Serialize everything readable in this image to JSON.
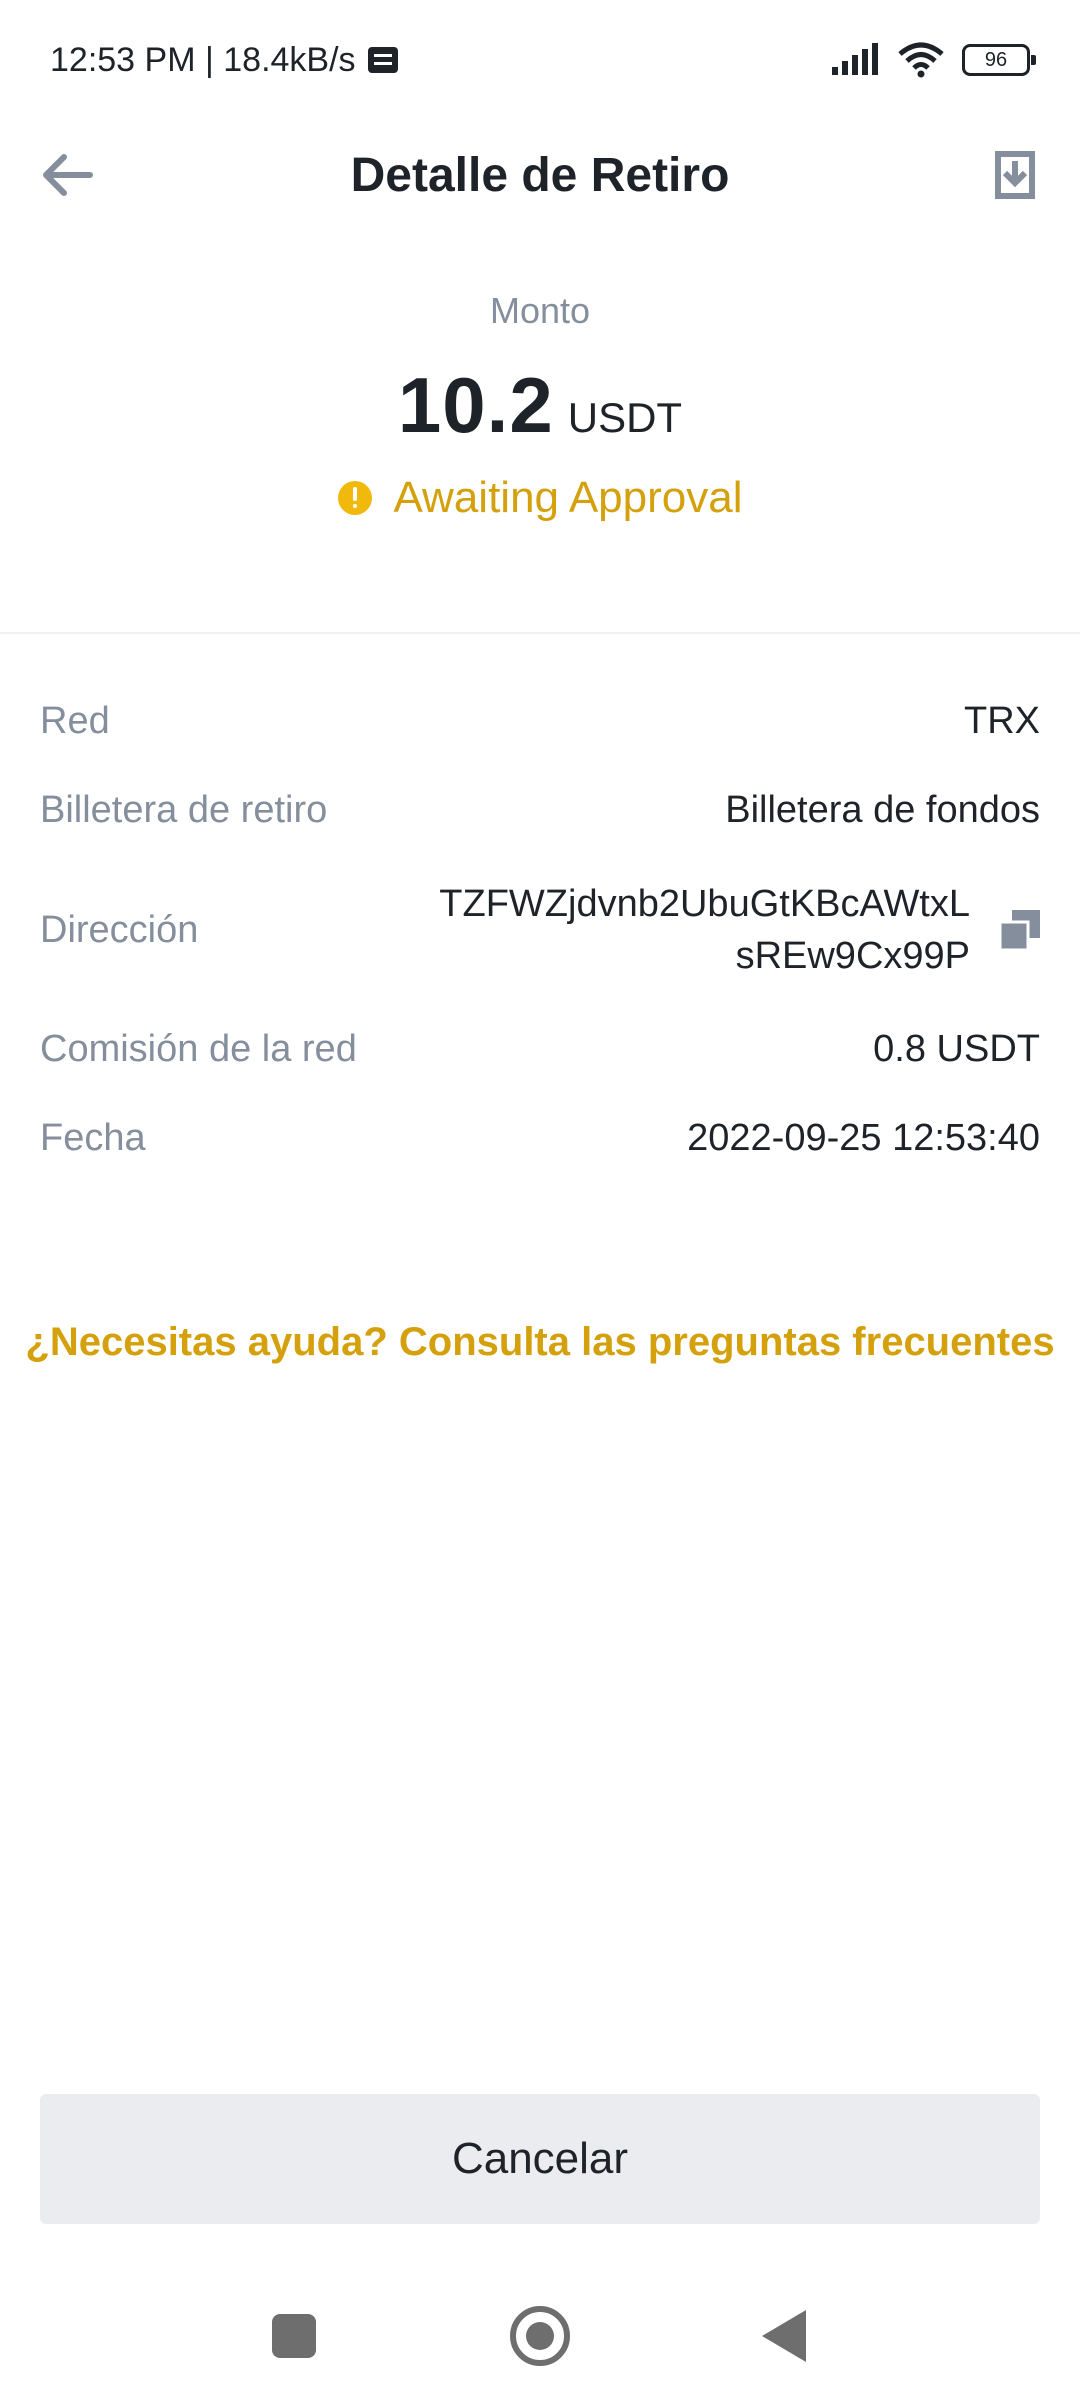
{
  "status_bar": {
    "time_speed": "12:53 PM | 18.4kB/s",
    "battery": "96"
  },
  "header": {
    "title": "Detalle de Retiro",
    "back_icon": "arrow-left-icon",
    "download_icon": "download-icon"
  },
  "amount": {
    "label": "Monto",
    "value": "10.2",
    "unit": "USDT",
    "status": "Awaiting Approval"
  },
  "details": [
    {
      "label": "Red",
      "value": "TRX"
    },
    {
      "label": "Billetera de retiro",
      "value": "Billetera de fondos"
    },
    {
      "label": "Dirección",
      "value_line1": "TZFWZjdvnb2UbuGtKBcAWtxL",
      "value_line2": "sREw9Cx99P"
    },
    {
      "label": "Comisión de la red",
      "value": "0.8 USDT"
    },
    {
      "label": "Fecha",
      "value": "2022-09-25 12:53:40"
    }
  ],
  "help_link": "¿Necesitas ayuda? Consulta las preguntas frecuentes",
  "cancel_button": "Cancelar",
  "colors": {
    "accent": "#F0B90B",
    "accent_text": "#D4A00B",
    "label_gray": "#848E9C",
    "text_dark": "#1E2329",
    "button_bg": "#EAECEF"
  }
}
